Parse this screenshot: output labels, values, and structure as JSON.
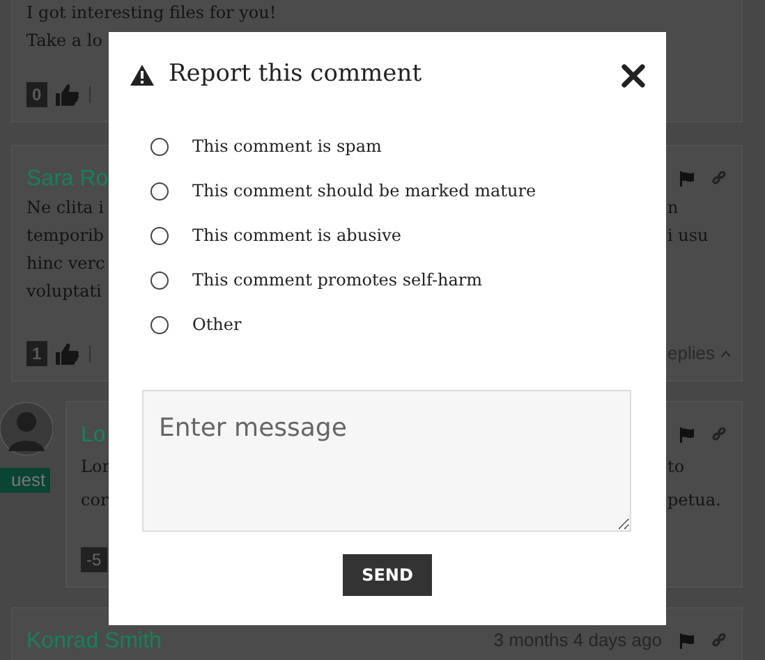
{
  "comments": [
    {
      "kind": "comment",
      "lines": [
        {
          "left": "I got interesting files for you!"
        },
        {
          "left": "Take a lo"
        }
      ],
      "votes": "0"
    },
    {
      "kind": "comment",
      "author": "Sara Ro",
      "lines": [
        {
          "left": "Ne clita i",
          "right": "n"
        },
        {
          "left": "temporib",
          "right": "i usu"
        },
        {
          "left": "hinc verc"
        },
        {
          "left": "voluptati"
        }
      ],
      "votes": "1",
      "replies": "eplies"
    },
    {
      "kind": "reply",
      "author": "Lo",
      "badge": "uest",
      "lines": [
        {
          "left": "Lor",
          "right": "to"
        },
        {
          "left": "cor",
          "right": "petua."
        }
      ],
      "votes": "-5"
    },
    {
      "kind": "comment",
      "author": "Konrad Smith",
      "time": "3 months 4 days ago"
    }
  ],
  "modal": {
    "title": "Report this comment",
    "options": [
      {
        "label": "This comment is spam",
        "selected": false
      },
      {
        "label": "This comment should be marked mature",
        "selected": false
      },
      {
        "label": "This comment is abusive",
        "selected": false
      },
      {
        "label": "This comment promotes self-harm",
        "selected": false
      },
      {
        "label": "Other",
        "selected": false
      }
    ],
    "message": {
      "placeholder": "Enter message"
    },
    "send": "SEND"
  }
}
